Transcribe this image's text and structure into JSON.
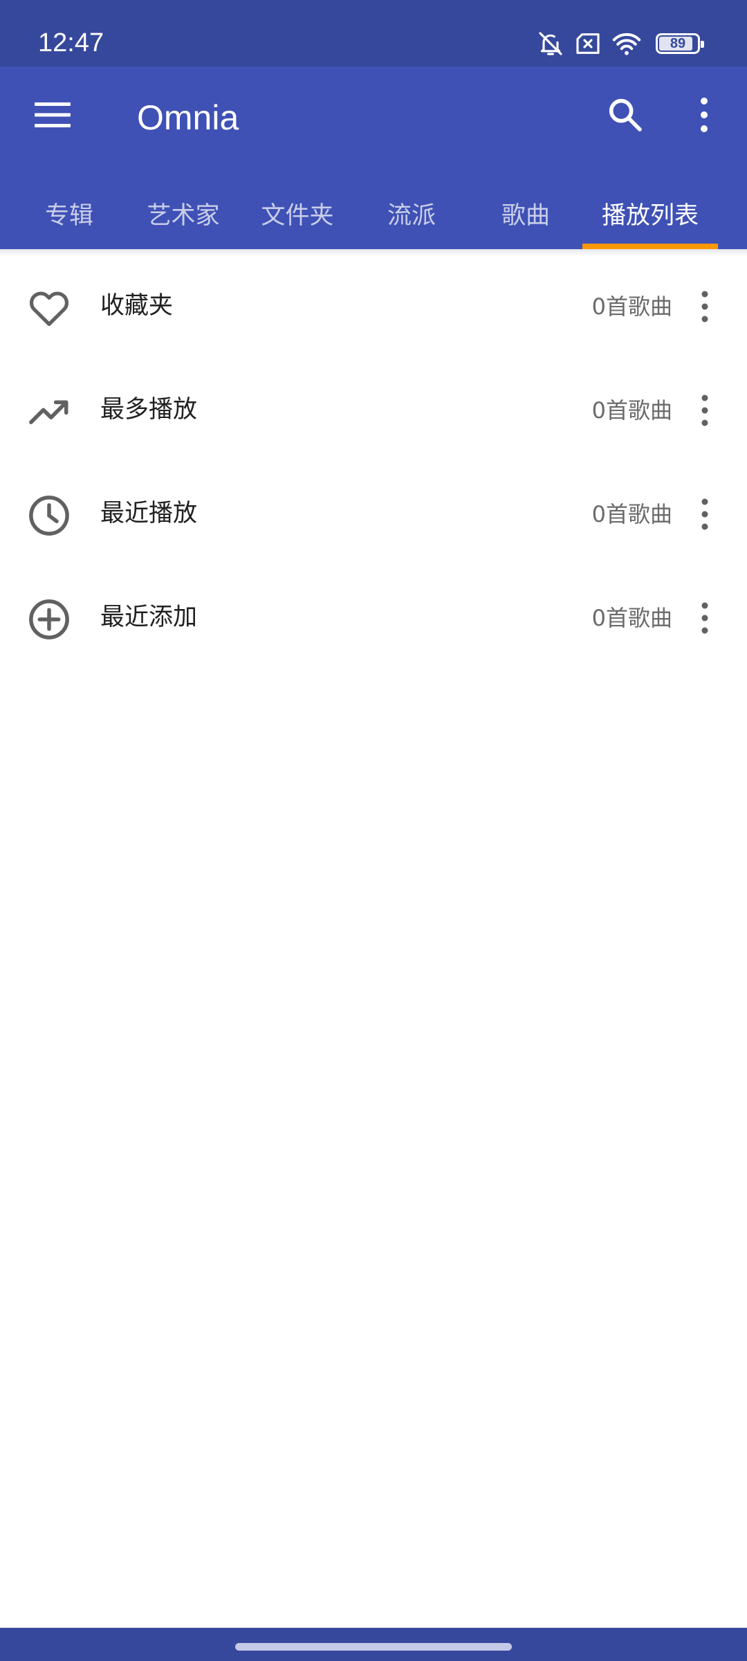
{
  "status_bar": {
    "time": "12:47",
    "battery_level": "89",
    "icons": [
      "bell-off-icon",
      "sim-off-icon",
      "wifi-icon",
      "battery-icon"
    ]
  },
  "app_bar": {
    "title": "Omnia",
    "icons": [
      "menu-icon",
      "search-icon",
      "more-vert-icon"
    ],
    "tabs": [
      {
        "label": "专辑"
      },
      {
        "label": "艺术家"
      },
      {
        "label": "文件夹"
      },
      {
        "label": "流派"
      },
      {
        "label": "歌曲"
      },
      {
        "label": "播放列表",
        "active": true
      }
    ]
  },
  "playlists": [
    {
      "icon": "heart-outline-icon",
      "name": "收藏夹",
      "count": "0首歌曲"
    },
    {
      "icon": "trending-up-icon",
      "name": "最多播放",
      "count": "0首歌曲"
    },
    {
      "icon": "clock-icon",
      "name": "最近播放",
      "count": "0首歌曲"
    },
    {
      "icon": "add-circle-icon",
      "name": "最近添加",
      "count": "0首歌曲"
    }
  ],
  "colors": {
    "status_bar": "#36489b",
    "app_bar": "#3f51b5",
    "tab_indicator": "#ff9800",
    "icon_gray": "#616161"
  }
}
